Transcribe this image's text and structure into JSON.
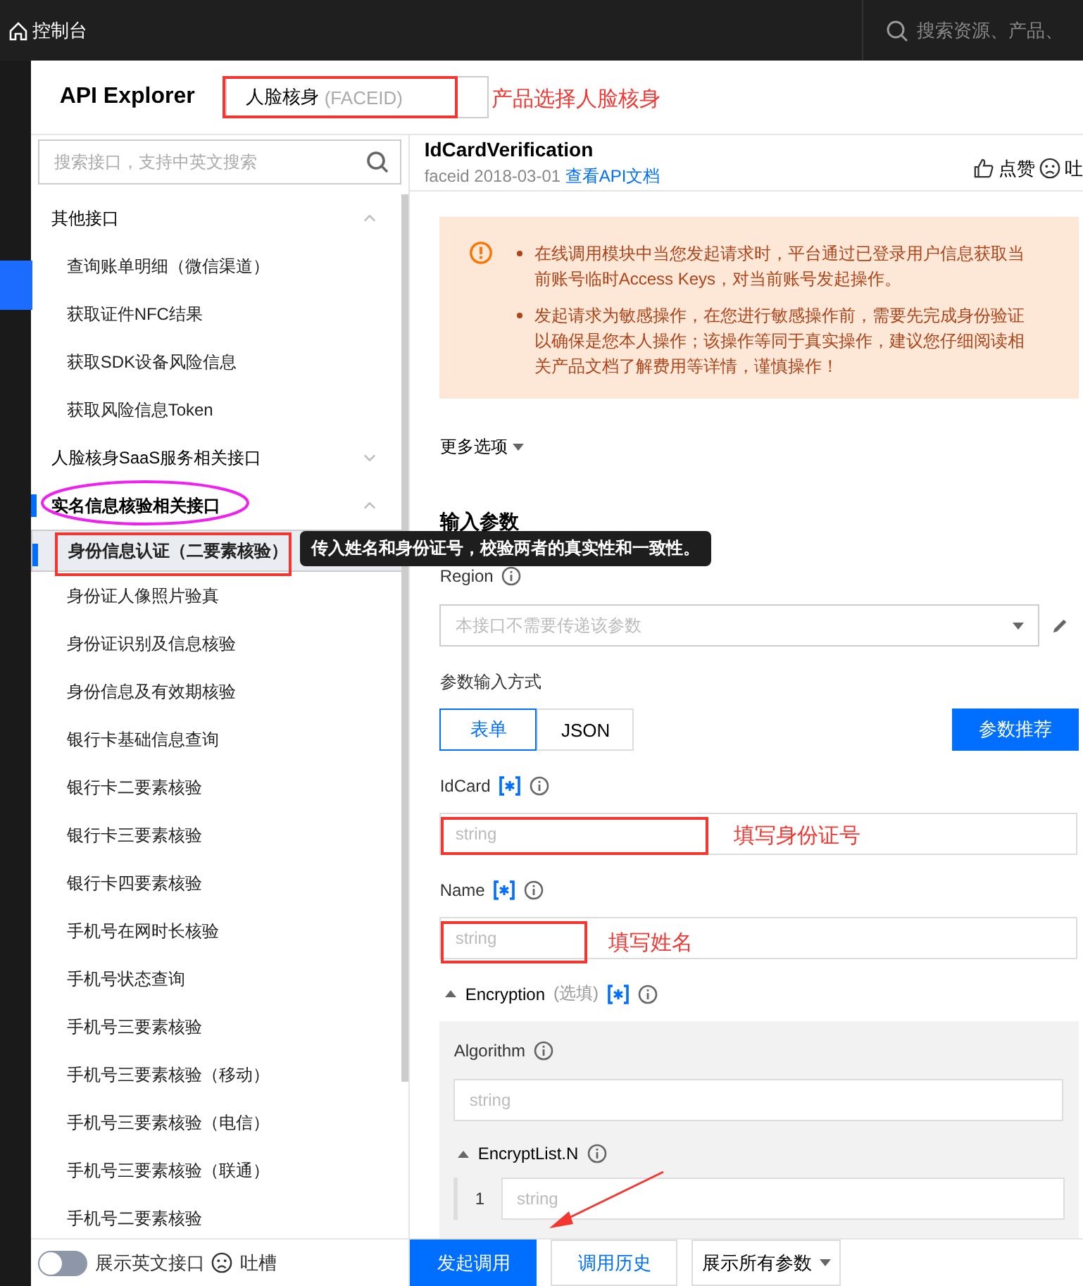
{
  "topbar": {
    "home_label": "控制台",
    "search_placeholder": "搜索资源、产品、"
  },
  "header": {
    "title": "API Explorer",
    "product_select": {
      "value": "人脸核身",
      "hint": "(FACEID)"
    },
    "annotation": "产品选择人脸核身"
  },
  "sidebar": {
    "search_placeholder": "搜索接口，支持中英文搜索",
    "groups": [
      {
        "label": "其他接口",
        "expanded": true,
        "selected": false,
        "children": [
          {
            "label": "查询账单明细（微信渠道）",
            "selected": false
          },
          {
            "label": "获取证件NFC结果",
            "selected": false
          },
          {
            "label": "获取SDK设备风险信息",
            "selected": false
          },
          {
            "label": "获取风险信息Token",
            "selected": false
          }
        ]
      },
      {
        "label": "人脸核身SaaS服务相关接口",
        "expanded": false,
        "selected": false
      },
      {
        "label": "实名信息核验相关接口",
        "expanded": true,
        "selected": true,
        "children": [
          {
            "label": "身份信息认证（二要素核验）",
            "selected": true
          },
          {
            "label": "身份证人像照片验真",
            "selected": false
          },
          {
            "label": "身份证识别及信息核验",
            "selected": false
          },
          {
            "label": "身份信息及有效期核验",
            "selected": false
          },
          {
            "label": "银行卡基础信息查询",
            "selected": false
          },
          {
            "label": "银行卡二要素核验",
            "selected": false
          },
          {
            "label": "银行卡三要素核验",
            "selected": false
          },
          {
            "label": "银行卡四要素核验",
            "selected": false
          },
          {
            "label": "手机号在网时长核验",
            "selected": false
          },
          {
            "label": "手机号状态查询",
            "selected": false
          },
          {
            "label": "手机号三要素核验",
            "selected": false
          },
          {
            "label": "手机号三要素核验（移动）",
            "selected": false
          },
          {
            "label": "手机号三要素核验（电信）",
            "selected": false
          },
          {
            "label": "手机号三要素核验（联通）",
            "selected": false
          },
          {
            "label": "手机号二要素核验",
            "selected": false
          }
        ]
      }
    ],
    "footer": {
      "toggle_label": "展示英文接口",
      "toggle_on": false,
      "feedback": "吐槽"
    }
  },
  "tooltip": "传入姓名和身份证号，校验两者的真实性和一致性。",
  "api": {
    "name": "IdCardVerification",
    "meta": "faceid 2018-03-01",
    "doc_link": "查看API文档",
    "like": "点赞",
    "feedback": "吐"
  },
  "notice": [
    "在线调用模块中当您发起请求时，平台通过已登录用户信息获取当前账号临时Access Keys，对当前账号发起操作。",
    "发起请求为敏感操作，在您进行敏感操作前，需要先完成身份验证以确保是您本人操作；该操作等同于真实操作，建议您仔细阅读相关产品文档了解费用等详情，谨慎操作！"
  ],
  "more_options": "更多选项",
  "params_heading": "输入参数",
  "region": {
    "label": "Region",
    "placeholder": "本接口不需要传递该参数"
  },
  "input_mode": {
    "label": "参数输入方式",
    "modes": [
      {
        "label": "表单",
        "selected": true
      },
      {
        "label": "JSON",
        "selected": false
      }
    ],
    "recommend": "参数推荐"
  },
  "fields": [
    {
      "label": "IdCard",
      "required": true,
      "placeholder": "string",
      "annotation": "填写身份证号"
    },
    {
      "label": "Name",
      "required": true,
      "placeholder": "string",
      "annotation": "填写姓名"
    }
  ],
  "encryption": {
    "label": "Encryption",
    "optional": "(选填)",
    "required": true,
    "expanded": true,
    "algorithm": {
      "label": "Algorithm",
      "placeholder": "string"
    },
    "list": {
      "label": "EncryptList.N",
      "expanded": true,
      "items": [
        {
          "index": "1",
          "placeholder": "string"
        }
      ]
    }
  },
  "actions": {
    "submit": "发起调用",
    "history": "调用历史",
    "show_all": "展示所有参数"
  }
}
